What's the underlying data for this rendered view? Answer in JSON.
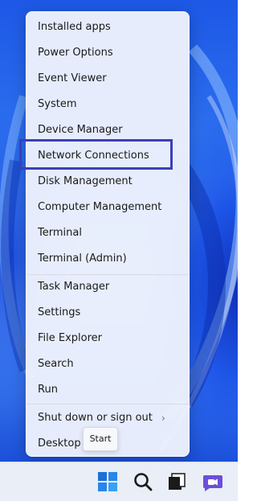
{
  "menu": {
    "items": [
      {
        "label": "Installed apps"
      },
      {
        "label": "Power Options"
      },
      {
        "label": "Event Viewer"
      },
      {
        "label": "System"
      },
      {
        "label": "Device Manager"
      },
      {
        "label": "Network Connections"
      },
      {
        "label": "Disk Management"
      },
      {
        "label": "Computer Management"
      },
      {
        "label": "Terminal"
      },
      {
        "label": "Terminal (Admin)"
      },
      {
        "label": "Task Manager"
      },
      {
        "label": "Settings"
      },
      {
        "label": "File Explorer"
      },
      {
        "label": "Search"
      },
      {
        "label": "Run"
      },
      {
        "label": "Shut down or sign out"
      },
      {
        "label": "Desktop"
      }
    ],
    "submenu_arrow": "›"
  },
  "tooltip": {
    "text": "Start"
  },
  "taskbar": {
    "icons": [
      "windows-start-icon",
      "search-icon",
      "task-view-icon",
      "chat-icon"
    ]
  },
  "colors": {
    "highlight_border": "#3a3fb8",
    "accent": "#1f6fd6"
  }
}
